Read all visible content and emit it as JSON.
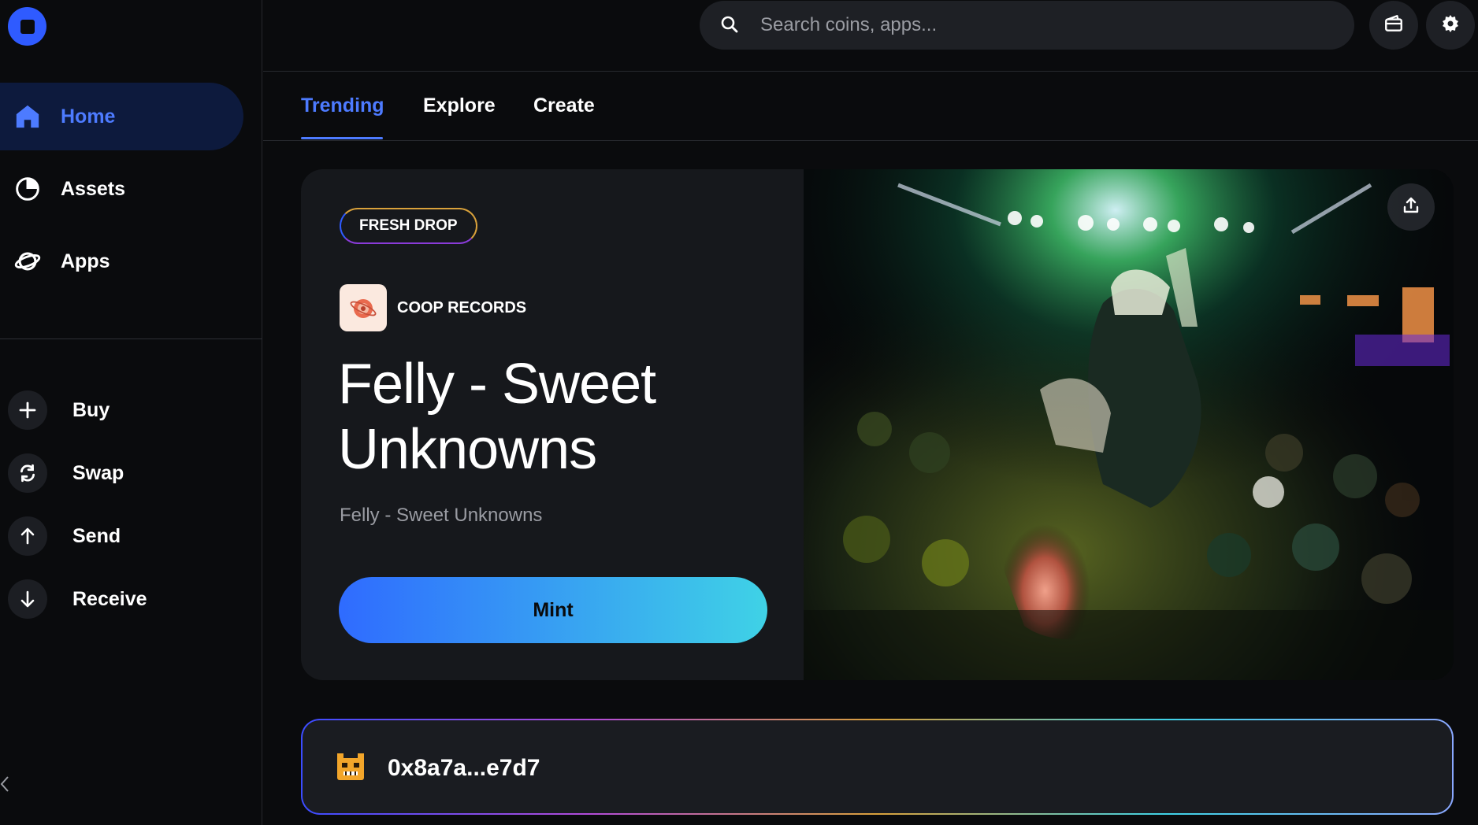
{
  "sidebar": {
    "nav": [
      {
        "label": "Home",
        "icon": "home-icon",
        "active": true
      },
      {
        "label": "Assets",
        "icon": "pie-chart-icon",
        "active": false
      },
      {
        "label": "Apps",
        "icon": "planet-icon",
        "active": false
      }
    ],
    "actions": [
      {
        "label": "Buy",
        "icon": "plus-icon"
      },
      {
        "label": "Swap",
        "icon": "swap-icon"
      },
      {
        "label": "Send",
        "icon": "arrow-up-icon"
      },
      {
        "label": "Receive",
        "icon": "arrow-down-icon"
      }
    ]
  },
  "search": {
    "placeholder": "Search coins, apps..."
  },
  "tabs": [
    {
      "label": "Trending",
      "active": true
    },
    {
      "label": "Explore",
      "active": false
    },
    {
      "label": "Create",
      "active": false
    }
  ],
  "hero": {
    "badge": "FRESH DROP",
    "creator": "COOP RECORDS",
    "title": "Felly - Sweet Unknowns",
    "subtitle": "Felly - Sweet Unknowns",
    "mint_label": "Mint"
  },
  "wallet": {
    "address": "0x8a7a...e7d7"
  },
  "colors": {
    "accent": "#4d7bff",
    "brand": "#2f5bff",
    "background": "#0a0b0d",
    "card": "#16181c"
  }
}
